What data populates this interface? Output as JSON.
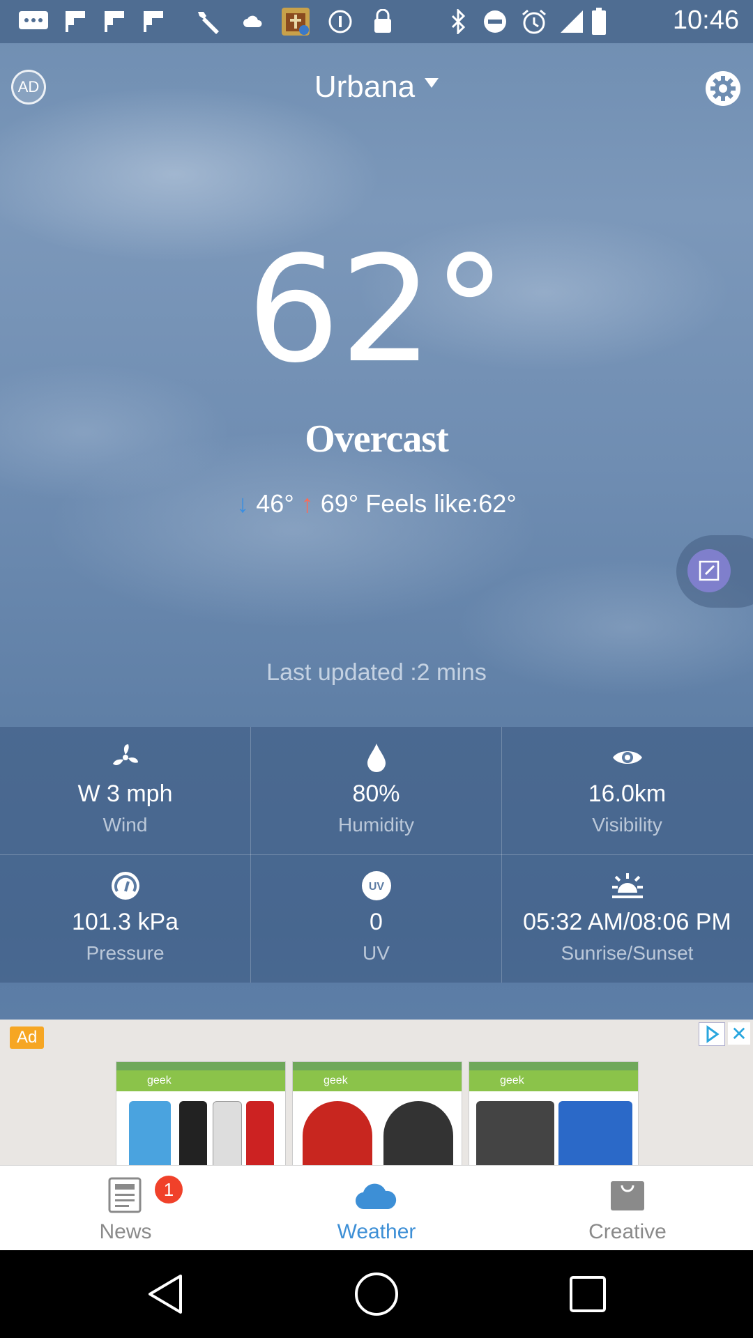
{
  "status_bar": {
    "time": "10:46",
    "icons": [
      "chat-icon",
      "flipboard-icon",
      "flipboard-icon",
      "flipboard-icon",
      "wrench-icon",
      "cloud-icon",
      "topics-app-icon",
      "info-icon",
      "lock-icon",
      "bluetooth-icon",
      "dnd-icon",
      "alarm-icon",
      "signal-icon",
      "battery-icon"
    ]
  },
  "header": {
    "ad_label": "AD",
    "city": "Urbana"
  },
  "current": {
    "temperature": "62°",
    "condition": "Overcast",
    "low": "46°",
    "high": "69°",
    "feels_like": "Feels like:62°",
    "last_updated": "Last updated :2 mins"
  },
  "stats": [
    {
      "icon": "wind-icon",
      "value": "W 3 mph",
      "label": "Wind"
    },
    {
      "icon": "humidity-drop-icon",
      "value": "80%",
      "label": "Humidity"
    },
    {
      "icon": "eye-icon",
      "value": "16.0km",
      "label": "Visibility"
    },
    {
      "icon": "pressure-gauge-icon",
      "value": "101.3 kPa",
      "label": "Pressure"
    },
    {
      "icon": "uv-icon",
      "value": "0",
      "label": "UV"
    },
    {
      "icon": "sunrise-icon",
      "value": "05:32 AM/08:06 PM",
      "label": "Sunrise/Sunset"
    }
  ],
  "ad": {
    "tag": "Ad",
    "close": "✕",
    "search_text": "geek"
  },
  "bottom_nav": {
    "items": [
      {
        "label": "News",
        "badge": "1",
        "icon": "news-icon"
      },
      {
        "label": "Weather",
        "icon": "cloud-icon",
        "active": true
      },
      {
        "label": "Creative",
        "icon": "bag-icon"
      }
    ]
  },
  "colors": {
    "accent": "#3d8fd6",
    "badge": "#f0412a",
    "low_arrow": "#3b8fe0",
    "high_arrow": "#ff6a55"
  }
}
